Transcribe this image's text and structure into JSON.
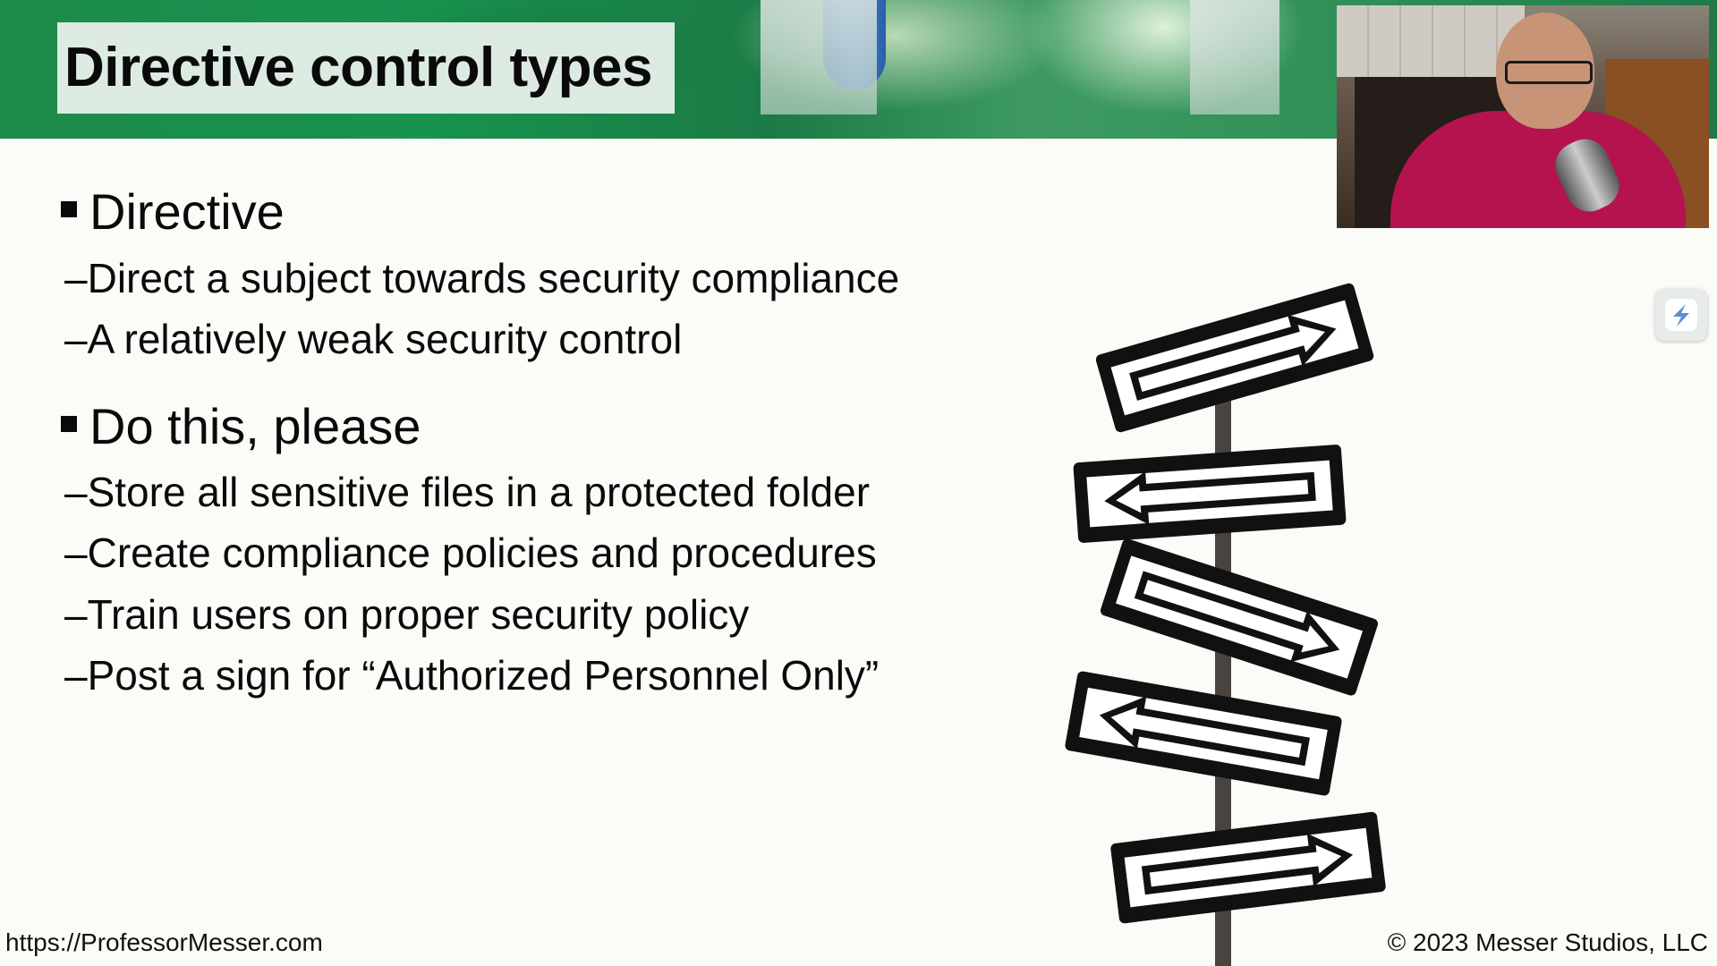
{
  "slide": {
    "title": "Directive control types",
    "sections": [
      {
        "heading": "Directive",
        "items": [
          "Direct a subject towards security compliance",
          "A relatively weak security control"
        ]
      },
      {
        "heading": "Do this, please",
        "items": [
          "Store all sensitive files in a protected folder",
          "Create compliance policies and procedures",
          "Train users on proper security policy",
          "Post a sign for “Authorized Personnel Only”"
        ]
      }
    ],
    "sub_prefix": "–",
    "footer_url": "https://ProfessorMesser.com",
    "footer_copyright": "© 2023 Messer Studios, LLC"
  },
  "icons": {
    "overlay_app": "slides-app-icon",
    "presenter": "presenter-webcam",
    "image": "direction-arrow-signs"
  },
  "colors": {
    "banner_green": "#1d8a4a",
    "text": "#0a0a0a",
    "background": "#fbfcf8"
  }
}
